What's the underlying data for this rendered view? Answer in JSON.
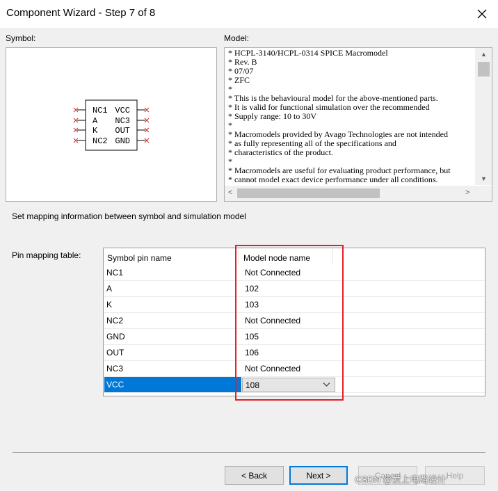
{
  "window": {
    "title": "Component Wizard - Step 7 of 8",
    "close_glyph": "✕"
  },
  "symbol": {
    "label": "Symbol:",
    "left_pins": [
      "NC1",
      "A",
      "K",
      "NC2"
    ],
    "right_pins": [
      "VCC",
      "NC3",
      "OUT",
      "GND"
    ],
    "pin_marker": "×"
  },
  "model": {
    "label": "Model:",
    "text": "* HCPL-3140/HCPL-0314 SPICE Macromodel\n* Rev. B\n* 07/07\n* ZFC\n*\n* This is the behavioural model for the above-mentioned parts.\n* It is valid for functional simulation over the recommended\n* Supply range: 10 to 30V\n*\n* Macromodels provided by Avago Technologies are not intended\n* as fully representing all of the specifications and\n* characteristics of the product.\n*\n* Macromodels are useful for evaluating product performance, but\n* cannot model exact device performance under all conditions.",
    "scroll_up": "▲",
    "scroll_down": "▼",
    "scroll_left": "<",
    "scroll_right": ">"
  },
  "mapping": {
    "instruction": "Set mapping information between symbol and simulation model",
    "table_label": "Pin mapping table:",
    "headers": {
      "symbol": "Symbol pin name",
      "model": "Model node name"
    },
    "rows": [
      {
        "symbol": "NC1",
        "model": "Not Connected"
      },
      {
        "symbol": "A",
        "model": "102"
      },
      {
        "symbol": "K",
        "model": "103"
      },
      {
        "symbol": "NC2",
        "model": "Not Connected"
      },
      {
        "symbol": "GND",
        "model": "105"
      },
      {
        "symbol": "OUT",
        "model": "106"
      },
      {
        "symbol": "NC3",
        "model": "Not Connected"
      }
    ],
    "selected_row": {
      "symbol": "VCC",
      "model": "108"
    },
    "highlight_color": "#e0202a",
    "selection_color": "#0078d7"
  },
  "buttons": {
    "back": "< Back",
    "next": "Next >",
    "cancel": "Cancel",
    "help": "Help"
  },
  "watermark": "CSDN @爱上电路设计"
}
